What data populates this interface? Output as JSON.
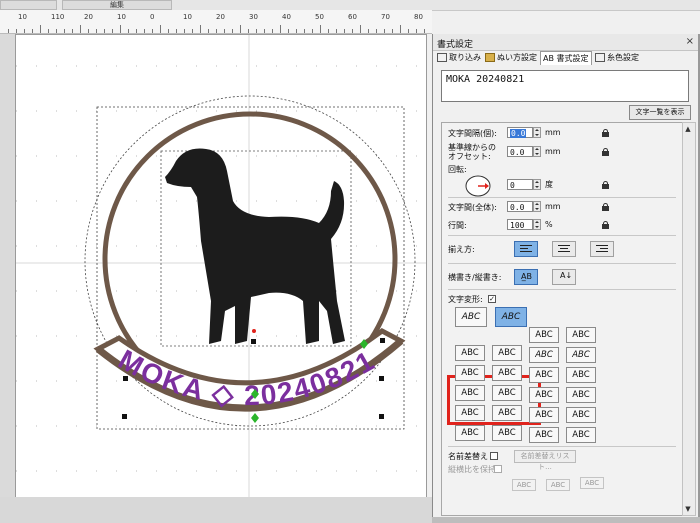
{
  "topbar": {
    "button1": "",
    "button2": "編集"
  },
  "ruler": {
    "labels": [
      "10",
      "110",
      "20",
      "10",
      "0",
      "10",
      "20",
      "30",
      "40",
      "50",
      "60",
      "70",
      "80"
    ]
  },
  "design": {
    "text": "MOKA ◇ 20240821",
    "text_color": "#7b2f9e",
    "ring_color": "#6e5848",
    "dog_color": "#1c1c1c"
  },
  "panel": {
    "title": "書式設定",
    "close": "×",
    "tabs": [
      {
        "label": "取り込み",
        "icon": "import-icon"
      },
      {
        "label": "ぬい方設定",
        "icon": "sewing-icon"
      },
      {
        "label": "AB 書式設定",
        "icon": "format-icon"
      },
      {
        "label": "糸色設定",
        "icon": "thread-icon"
      }
    ],
    "text_value": "MOKA 20240821",
    "show_list_button": "文字一覧を表示",
    "fields": {
      "spacing_label": "文字間隔(個):",
      "spacing_value": "0.0",
      "spacing_unit": "mm",
      "baseline_label1": "基準線からの",
      "baseline_label2": "オフセット:",
      "baseline_value": "0.0",
      "baseline_unit": "mm",
      "rotate_label": "回転:",
      "rotate_value": "0",
      "rotate_unit": "度",
      "total_spacing_label": "文字間(全体):",
      "total_spacing_value": "0.0",
      "total_spacing_unit": "mm",
      "line_spacing_label": "行間:",
      "line_spacing_value": "100",
      "line_spacing_unit": "%",
      "align_label": "揃え方:",
      "vertical_label": "横書き/縦書き:",
      "transform_label": "文字変形:",
      "name_replace_label": "名前差替え",
      "name_replace_button": "名前差替えリスト...",
      "disabled_label": "縦横比を保持"
    },
    "tile_text": "ABC"
  }
}
